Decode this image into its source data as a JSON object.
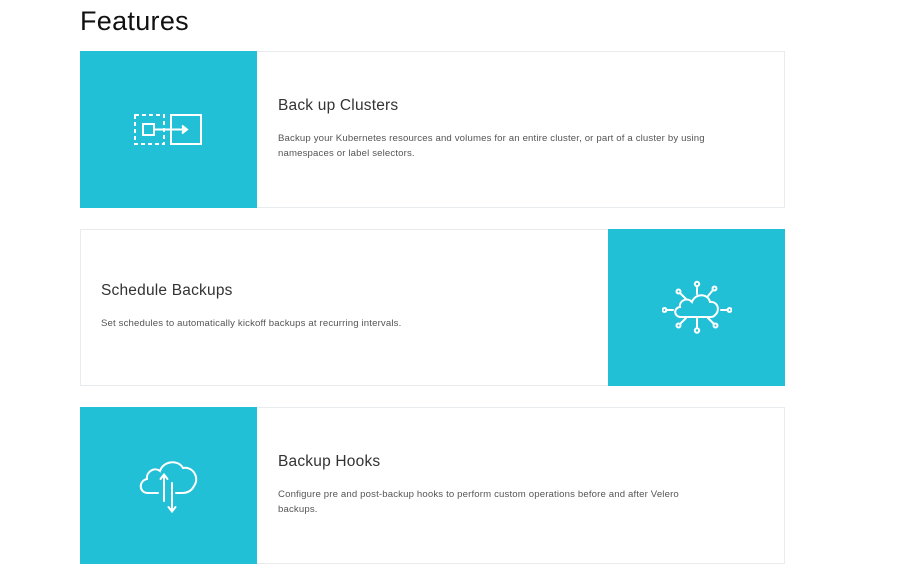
{
  "page": {
    "title": "Features"
  },
  "theme": {
    "accent": "#21c0d6",
    "card_border": "#e9ecef"
  },
  "features": [
    {
      "title": "Back up Clusters",
      "description": "Backup your Kubernetes resources and volumes for an entire cluster, or part of a cluster by using namespaces or label selectors.",
      "icon": "cluster-backup-icon"
    },
    {
      "title": "Schedule Backups",
      "description": "Set schedules to automatically kickoff backups at recurring intervals.",
      "icon": "cloud-network-icon"
    },
    {
      "title": "Backup Hooks",
      "description": "Configure pre and post-backup hooks to perform custom operations before and after Velero backups.",
      "icon": "cloud-sync-icon"
    }
  ]
}
